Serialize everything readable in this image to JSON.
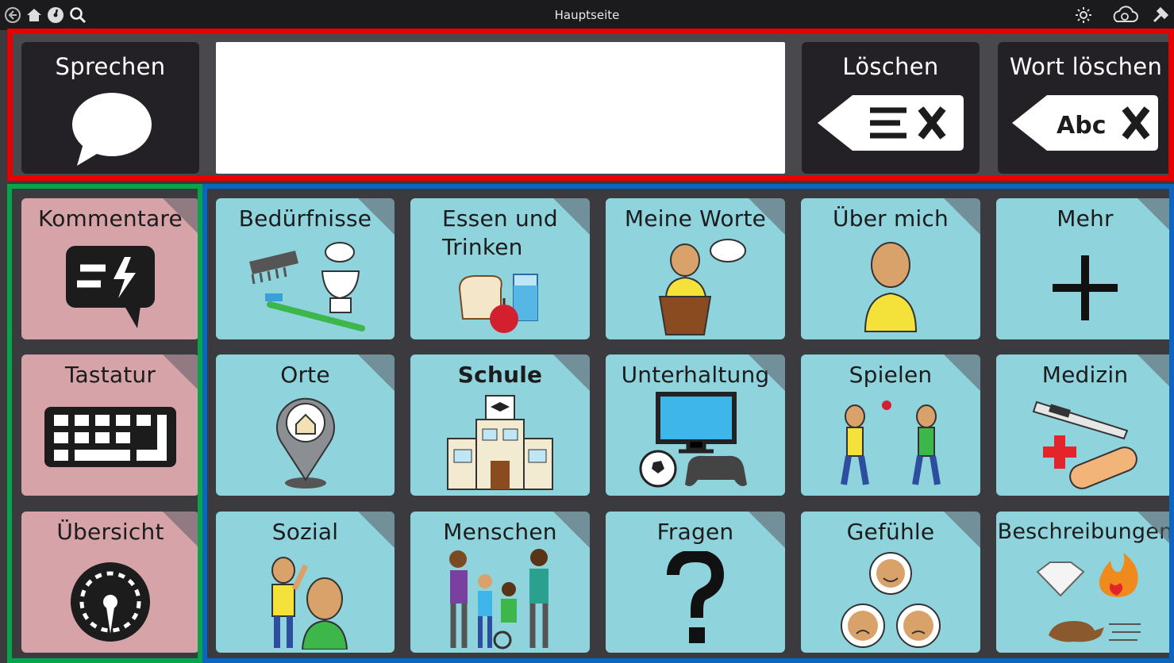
{
  "topbar": {
    "title": "Hauptseite",
    "left_icons": [
      "back-icon",
      "home-icon",
      "dashboard-icon",
      "search-icon"
    ],
    "right_icons": [
      "brightness-icon",
      "cloud-sync-icon",
      "settings-icon"
    ]
  },
  "message_bar": {
    "speak_label": "Sprechen",
    "message_text": "",
    "clear_label": "Löschen",
    "delete_word_label": "Wort löschen",
    "delete_word_icon_text": "Abc"
  },
  "side_tiles": [
    {
      "label": "Kommentare",
      "icon": "comment-lightning-icon"
    },
    {
      "label": "Tastatur",
      "icon": "keyboard-icon"
    },
    {
      "label": "Übersicht",
      "icon": "speedometer-icon"
    }
  ],
  "grid_tiles": [
    {
      "label": "Bedürfnisse",
      "icon": "toiletries-icon"
    },
    {
      "label": "Essen und Trinken",
      "icon": "food-drink-icon"
    },
    {
      "label": "Meine Worte",
      "icon": "speaker-podium-icon"
    },
    {
      "label": "Über mich",
      "icon": "person-self-icon"
    },
    {
      "label": "Mehr",
      "icon": "plus-icon"
    },
    {
      "label": "Orte",
      "icon": "location-pin-icon"
    },
    {
      "label": "Schule",
      "icon": "school-building-icon"
    },
    {
      "label": "Unterhaltung",
      "icon": "tv-game-icon"
    },
    {
      "label": "Spielen",
      "icon": "playing-catch-icon"
    },
    {
      "label": "Medizin",
      "icon": "thermometer-bandage-icon"
    },
    {
      "label": "Sozial",
      "icon": "greeting-people-icon"
    },
    {
      "label": "Menschen",
      "icon": "group-people-icon"
    },
    {
      "label": "Fragen",
      "icon": "question-mark-icon"
    },
    {
      "label": "Gefühle",
      "icon": "emotion-faces-icon"
    },
    {
      "label": "Beschreibungen",
      "icon": "diamond-fire-rabbit-icon"
    }
  ],
  "colors": {
    "topbar": "#1b1b1d",
    "dark_button": "#232126",
    "side_tile": "#d6a3a8",
    "grid_tile": "#8fd3dd",
    "annotation_red": "#e60000",
    "annotation_green": "#06a54a",
    "annotation_blue": "#0b66c2"
  }
}
